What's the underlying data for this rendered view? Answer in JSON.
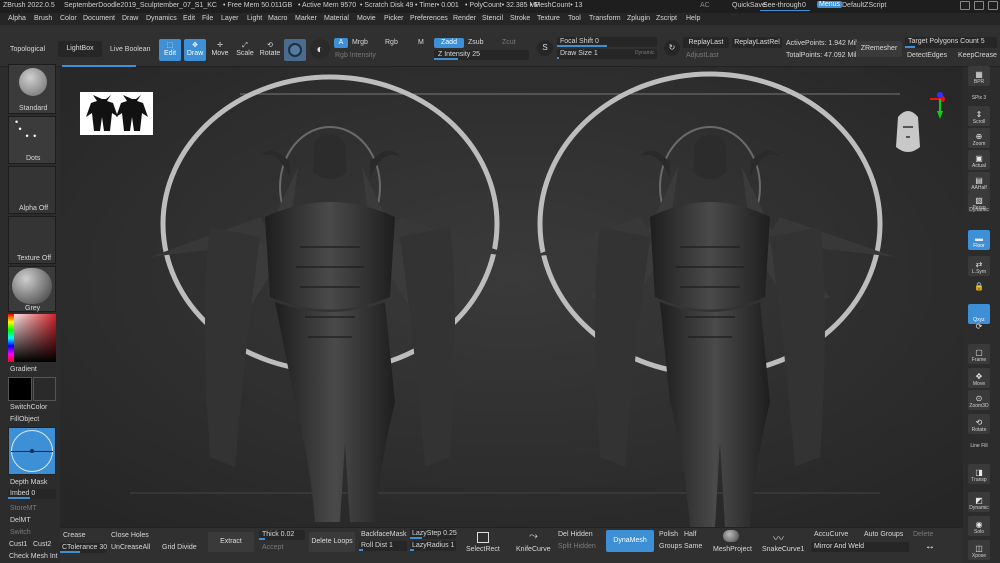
{
  "titlebar": {
    "app": "ZBrush 2022.0.5",
    "file": "SeptemberDoodle2019_Sculptember_07_S1_KC",
    "freemem": "• Free Mem 50.011GB",
    "activemem": "• Active Mem 9570",
    "scratch": "• Scratch Disk 49",
    "timer": "• Timer• 0.001",
    "polycount": "• PolyCount• 32.385 MP",
    "meshcount": "• MeshCount• 13",
    "ac": "AC",
    "quicksave": "QuickSave",
    "seethrough": "See-through",
    "seethrough_value": "0",
    "menus": "Menus",
    "defaultscript": "DefaultZScript"
  },
  "menu": [
    "Alpha",
    "Brush",
    "Color",
    "Document",
    "Draw",
    "Dynamics",
    "Edit",
    "File",
    "Layer",
    "Light",
    "Macro",
    "Marker",
    "Material",
    "Movie",
    "Picker",
    "Preferences",
    "Render",
    "Stencil",
    "Stroke",
    "Texture",
    "Tool",
    "Transform",
    "Zplugin",
    "Zscript",
    "Help"
  ],
  "topshelf": {
    "topological": "Topological",
    "lightbox": "LightBox",
    "liveboolean": "Live Boolean",
    "edit": "Edit",
    "draw": "Draw",
    "move": "Move",
    "scale": "Scale",
    "rotate": "Rotate",
    "a": "A",
    "mrgb": "Mrgb",
    "rgb": "Rgb",
    "m": "M",
    "zadd": "Zadd",
    "zsub": "Zsub",
    "zcut": "Zcut",
    "rgb_intensity": "Rgb Intensity",
    "z_intensity": "Z Intensity 25",
    "focal_shift": "Focal Shift 0",
    "draw_size": "Draw Size 1",
    "dynamic": "Dynamic",
    "replaylast": "ReplayLast",
    "replaylastrel": "ReplayLastRel",
    "adjustlast": "AdjustLast",
    "activepoints": "ActivePoints: 1.942 Mil",
    "totalpoints": "TotalPoints: 47.092 Mil",
    "zremesher": "ZRemesher",
    "target_polygons": "Target Polygons Count 5",
    "detectedges": "DetectEdges",
    "keepcrease": "KeepCrease"
  },
  "leftpanel": {
    "brush": "Standard",
    "stroke": "Dots",
    "alpha": "Alpha Off",
    "texture": "Texture Off",
    "material": "Grey",
    "gradient": "Gradient",
    "switchcolor": "SwitchColor",
    "fillobject": "FillObject",
    "depthmask": "Depth Mask",
    "imbed": "Imbed 0",
    "storemt": "StoreMT",
    "delmt": "DelMT",
    "switch": "Switch",
    "cust1": "Cust1",
    "cust2": "Cust2",
    "checkmesh": "Check Mesh Int"
  },
  "rightpanel": [
    "BPR",
    "SPix 3",
    "Scroll",
    "Zoom",
    "Actual",
    "AAHalf",
    "Persp",
    "Dynamic",
    "Floor",
    "L.Sym",
    "",
    "Qxyz",
    "",
    "",
    "Frame",
    "Move",
    "Zoom3D",
    "Rotate",
    "Line Fill",
    "Transp",
    "Dynamic",
    "Solo",
    "Xpose"
  ],
  "bottombar": {
    "crease": "Crease",
    "ctolerance": "CTolerance 30",
    "closeholes": "Close Holes",
    "uncreaseall": "UnCreaseAll",
    "griddivide": "Grid Divide",
    "extract": "Extract",
    "thick": "Thick 0.02",
    "accept": "Accept",
    "deleteloops": "Delete Loops",
    "backfacemask": "BackfaceMask",
    "rolldist": "Roll Dist 1",
    "lazystep": "LazyStep 0.25",
    "lazyradius": "LazyRadius 1",
    "selectrect": "SelectRect",
    "knifecurve": "KnifeCurve",
    "delhidden": "Del Hidden",
    "splithidden": "Split Hidden",
    "dynamesh": "DynaMesh",
    "polish": "Polish",
    "groups": "Groups",
    "half": "Half",
    "same": "Same",
    "meshproject": "MeshProject",
    "snakecurve": "SnakeCurve1",
    "accucurve": "AccuCurve",
    "autogroups": "Auto Groups",
    "delete": "Delete",
    "mirrorandweld": "Mirror And Weld"
  },
  "colors": {
    "accent": "#3d8fd6",
    "panel": "#303030",
    "bg": "#2f2f2f",
    "sculpt": "#3a3a3a"
  }
}
